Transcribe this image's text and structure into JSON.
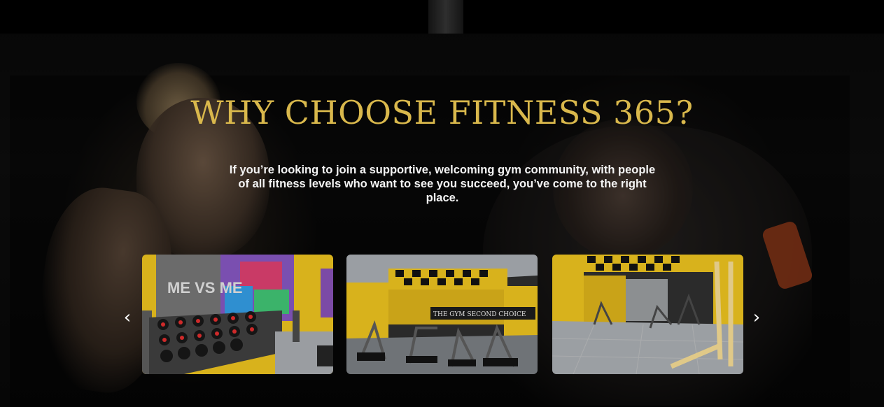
{
  "section": {
    "title": "WHY CHOOSE FITNESS 365?",
    "description": "If you’re looking to join a supportive, welcoming gym community, with people of all fitness levels who want to see you succeed, you’ve come to the right place."
  },
  "carousel": {
    "prev_icon": "chevron-left-icon",
    "next_icon": "chevron-right-icon",
    "prev_glyph": "‹",
    "next_glyph": "›",
    "slides": [
      {
        "name": "dumbbell-rack-photo",
        "wall_text": "ME VS ME"
      },
      {
        "name": "gym-floor-photo",
        "sign_text": "THE GYM   SECOND CHOICE"
      },
      {
        "name": "cardio-area-photo"
      }
    ]
  },
  "colors": {
    "title": "#d9b84c",
    "text": "#f4f4f4",
    "accent_yellow": "#d9b21a"
  }
}
